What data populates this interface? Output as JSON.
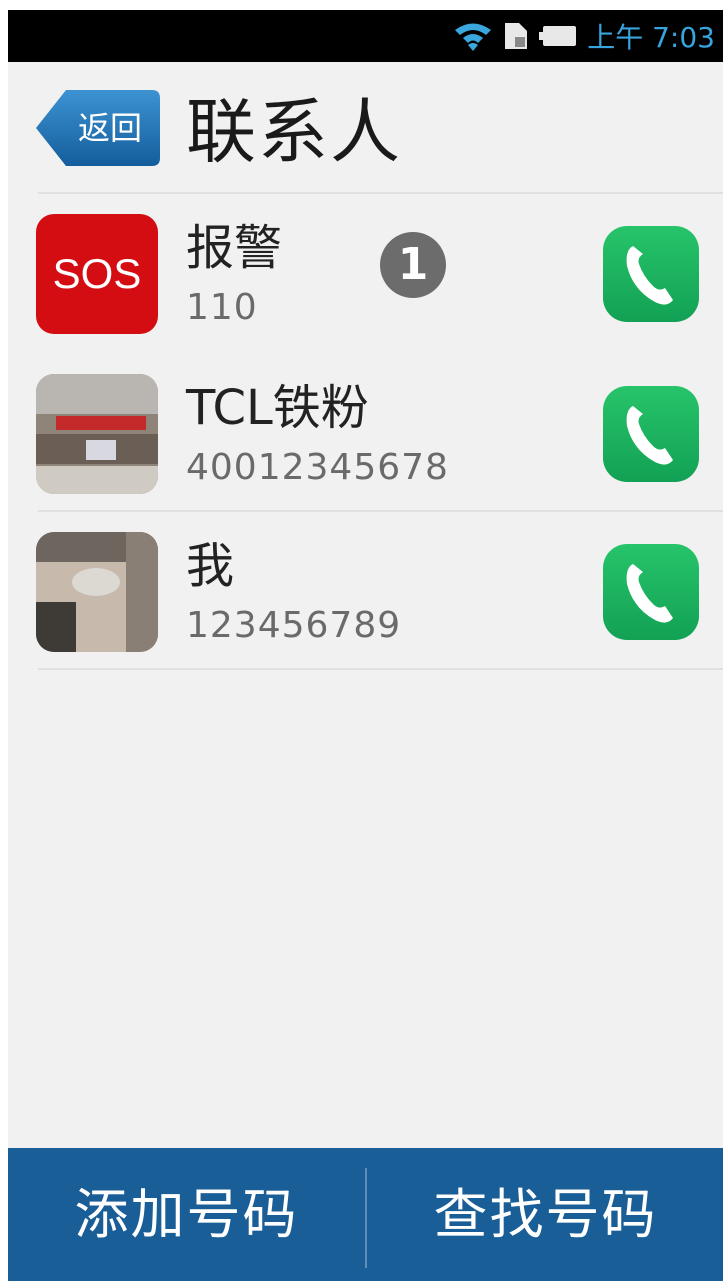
{
  "status_bar": {
    "time": "上午 7:03",
    "icons": [
      "wifi-icon",
      "sim-icon",
      "battery-icon"
    ]
  },
  "header": {
    "back_label": "返回",
    "title": "联系人"
  },
  "contacts": [
    {
      "name": "报警",
      "number": "110",
      "avatar_text": "SOS",
      "badge": "1"
    },
    {
      "name": "TCL铁粉",
      "number": "40012345678"
    },
    {
      "name": "我",
      "number": "123456789"
    }
  ],
  "bottom_bar": {
    "add_label": "添加号码",
    "find_label": "查找号码"
  },
  "colors": {
    "bottom_bar": "#1a5e97",
    "call_button": "#1fb25e",
    "sos": "#d40d12",
    "back_button": "#1e6fae"
  }
}
